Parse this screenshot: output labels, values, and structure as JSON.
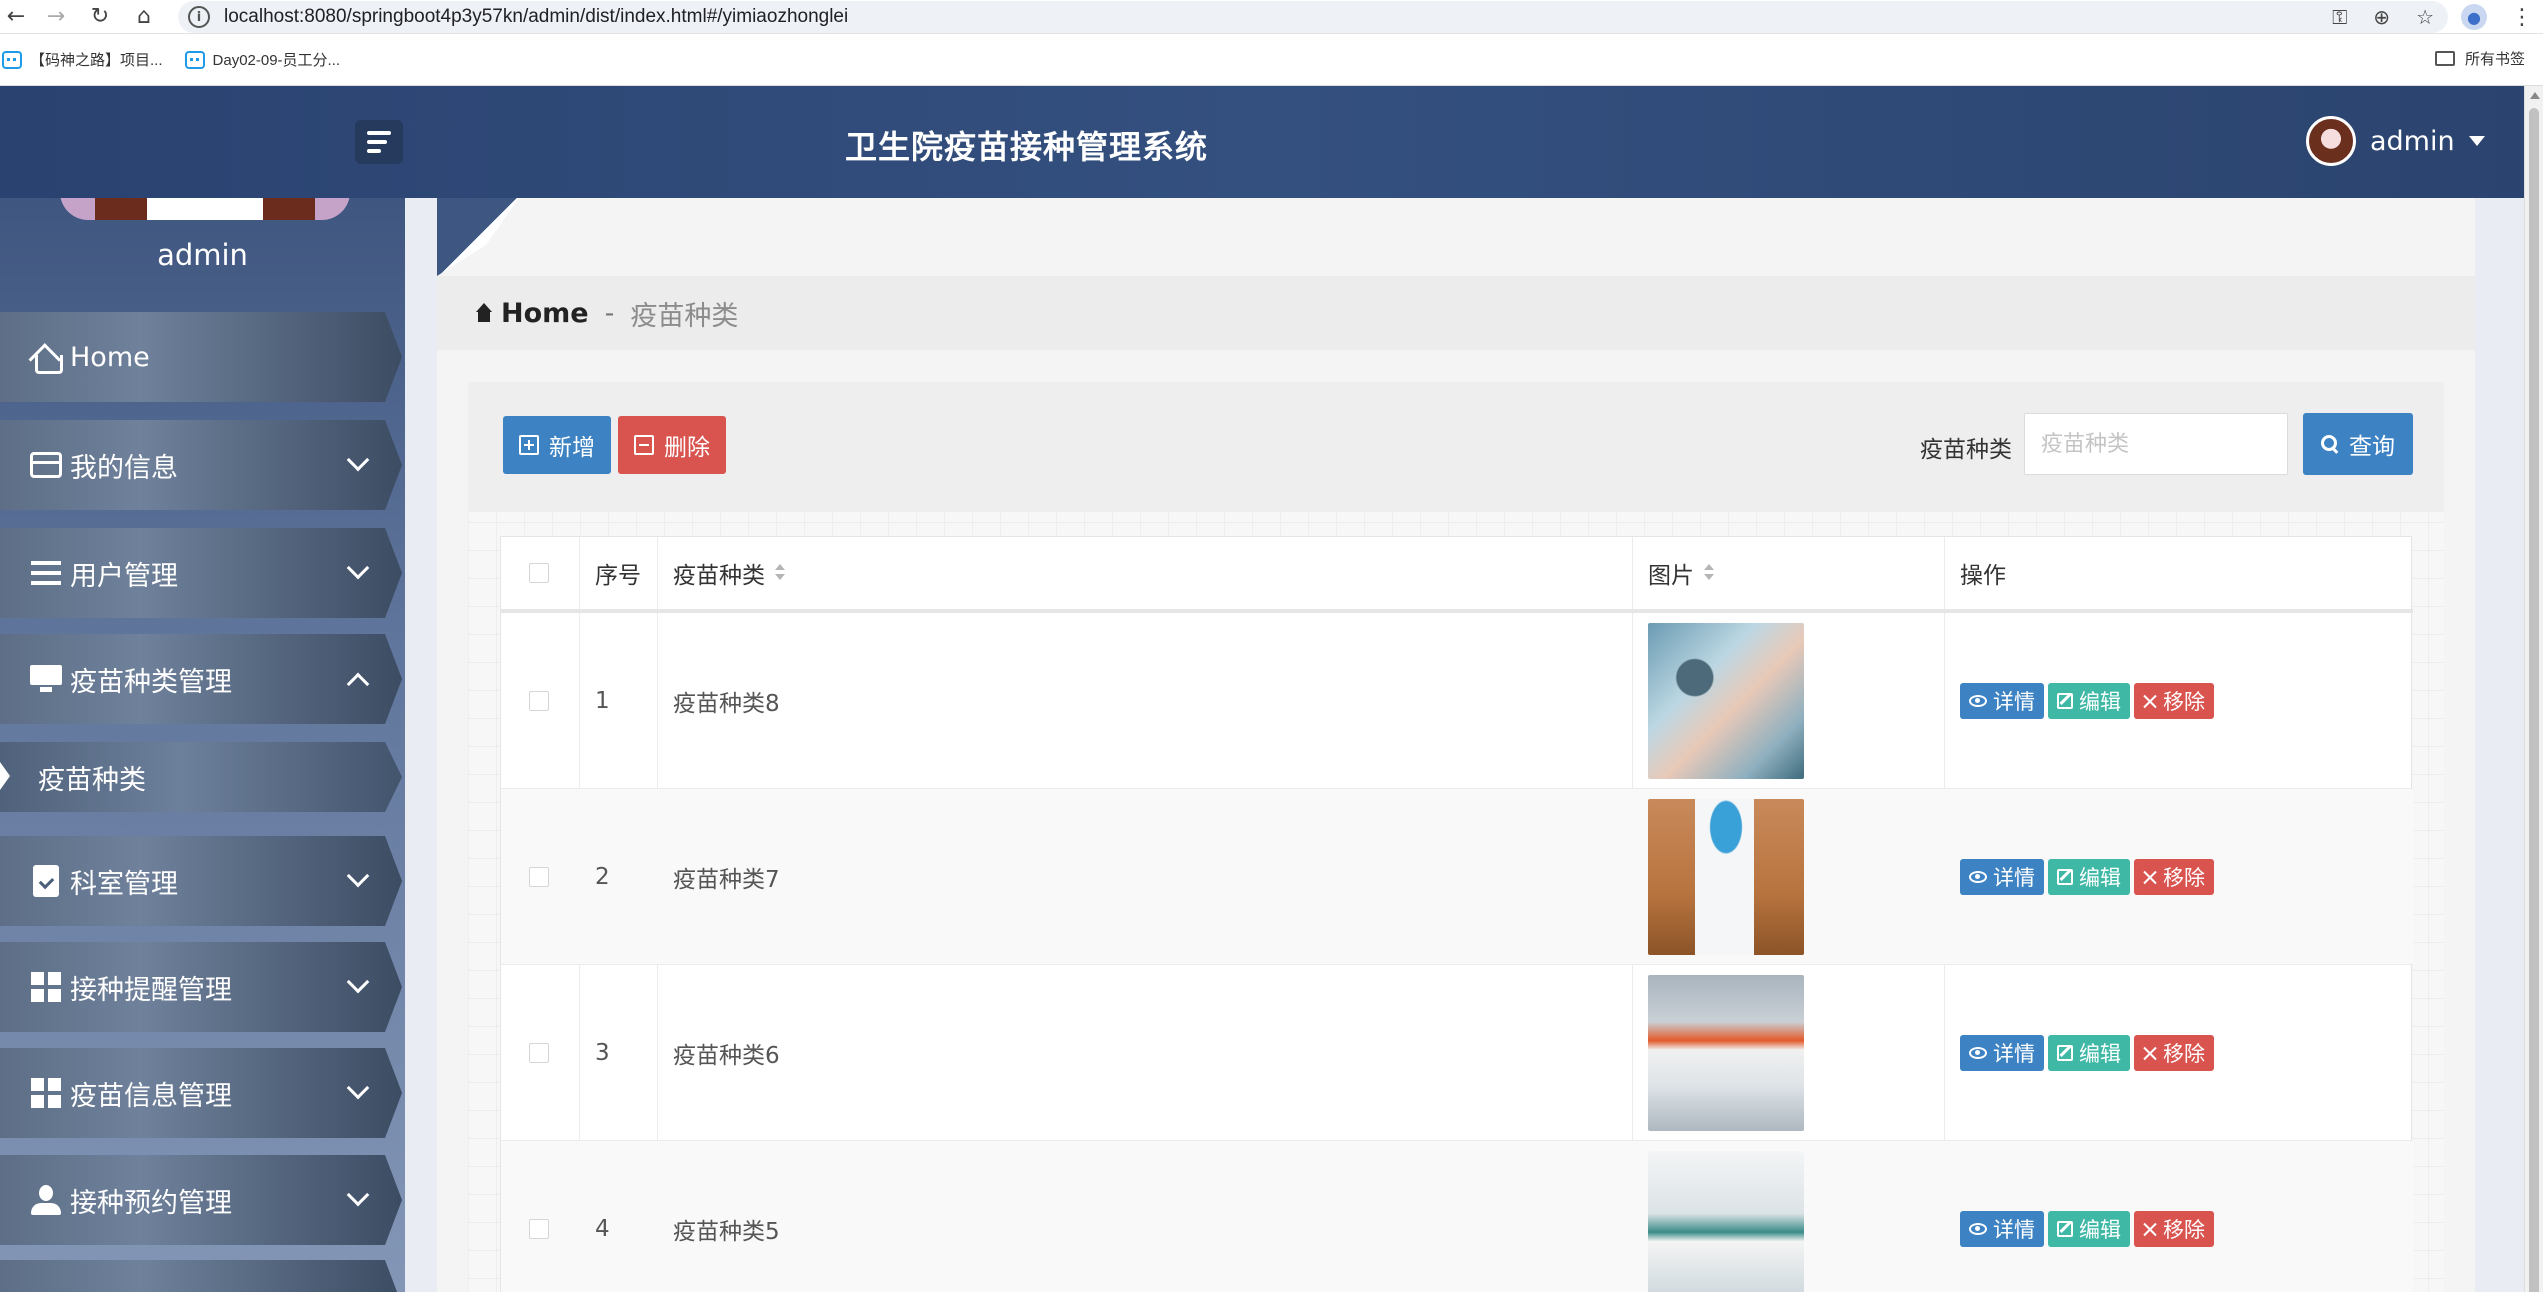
{
  "browser": {
    "url": "localhost:8080/springboot4p3y57kn/admin/dist/index.html#/yimiaozhonglei",
    "bookmarks": [
      "【码神之路】项目...",
      "Day02-09-员工分..."
    ],
    "all_bookmarks": "所有书签"
  },
  "header": {
    "title": "卫生院疫苗接种管理系统",
    "username": "admin"
  },
  "sidebar": {
    "username": "admin",
    "items": [
      {
        "label": "Home",
        "icon": "home-icon"
      },
      {
        "label": "我的信息",
        "icon": "id-card-icon"
      },
      {
        "label": "用户管理",
        "icon": "list-icon"
      },
      {
        "label": "疫苗种类管理",
        "icon": "monitor-icon",
        "expanded": true
      },
      {
        "label": "科室管理",
        "icon": "clipboard-icon"
      },
      {
        "label": "接种提醒管理",
        "icon": "grid-icon"
      },
      {
        "label": "疫苗信息管理",
        "icon": "grid-icon"
      },
      {
        "label": "接种预约管理",
        "icon": "person-icon"
      }
    ],
    "sub_item": "疫苗种类"
  },
  "breadcrumb": {
    "home": "Home",
    "separator": "-",
    "current": "疫苗种类"
  },
  "toolbar": {
    "add_label": "新增",
    "delete_label": "删除",
    "search_label": "疫苗种类",
    "search_placeholder": "疫苗种类",
    "search_button": "查询"
  },
  "table": {
    "headers": {
      "index": "序号",
      "category": "疫苗种类",
      "image": "图片",
      "actions": "操作"
    },
    "rows": [
      {
        "index": "1",
        "category": "疫苗种类8"
      },
      {
        "index": "2",
        "category": "疫苗种类7"
      },
      {
        "index": "3",
        "category": "疫苗种类6"
      },
      {
        "index": "4",
        "category": "疫苗种类5"
      }
    ],
    "actions": {
      "detail": "详情",
      "edit": "编辑",
      "remove": "移除"
    }
  },
  "colors": {
    "primary": "#3d83c4",
    "danger": "#d9534f",
    "teal": "#3fb8a6",
    "header_bg": "#2f4a78"
  }
}
